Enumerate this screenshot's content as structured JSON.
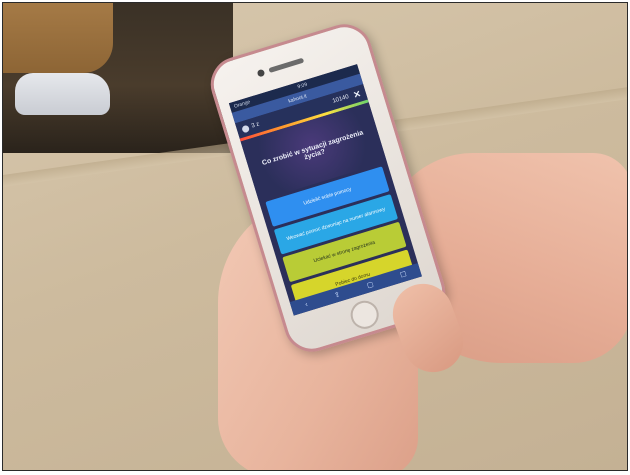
{
  "phone": {
    "status_bar": {
      "left": "Orange",
      "center": "9:09",
      "right": ""
    },
    "url": "kahoot.it",
    "quiz": {
      "score_label": "3 z",
      "points": "10140",
      "close_symbol": "✕",
      "question": "Co zrobić w sytuacji zagrożenia życia?",
      "answers": [
        "Udzielić sobie pomocy",
        "Wezwać pomoc dzwoniąc na numer alarmowy",
        "Uciekać w stronę zagrożenia",
        "Pobiec do domu"
      ]
    },
    "bottom_icons": [
      "back-icon",
      "share-icon",
      "tabs-icon",
      "bookmark-icon"
    ]
  },
  "colors": {
    "answer_blue": "#2f8ff0",
    "answer_cyan": "#2aa7e6",
    "answer_lime": "#b9cc36",
    "answer_yellow": "#d6d52b",
    "screen_bg": "#2b2f5a"
  }
}
